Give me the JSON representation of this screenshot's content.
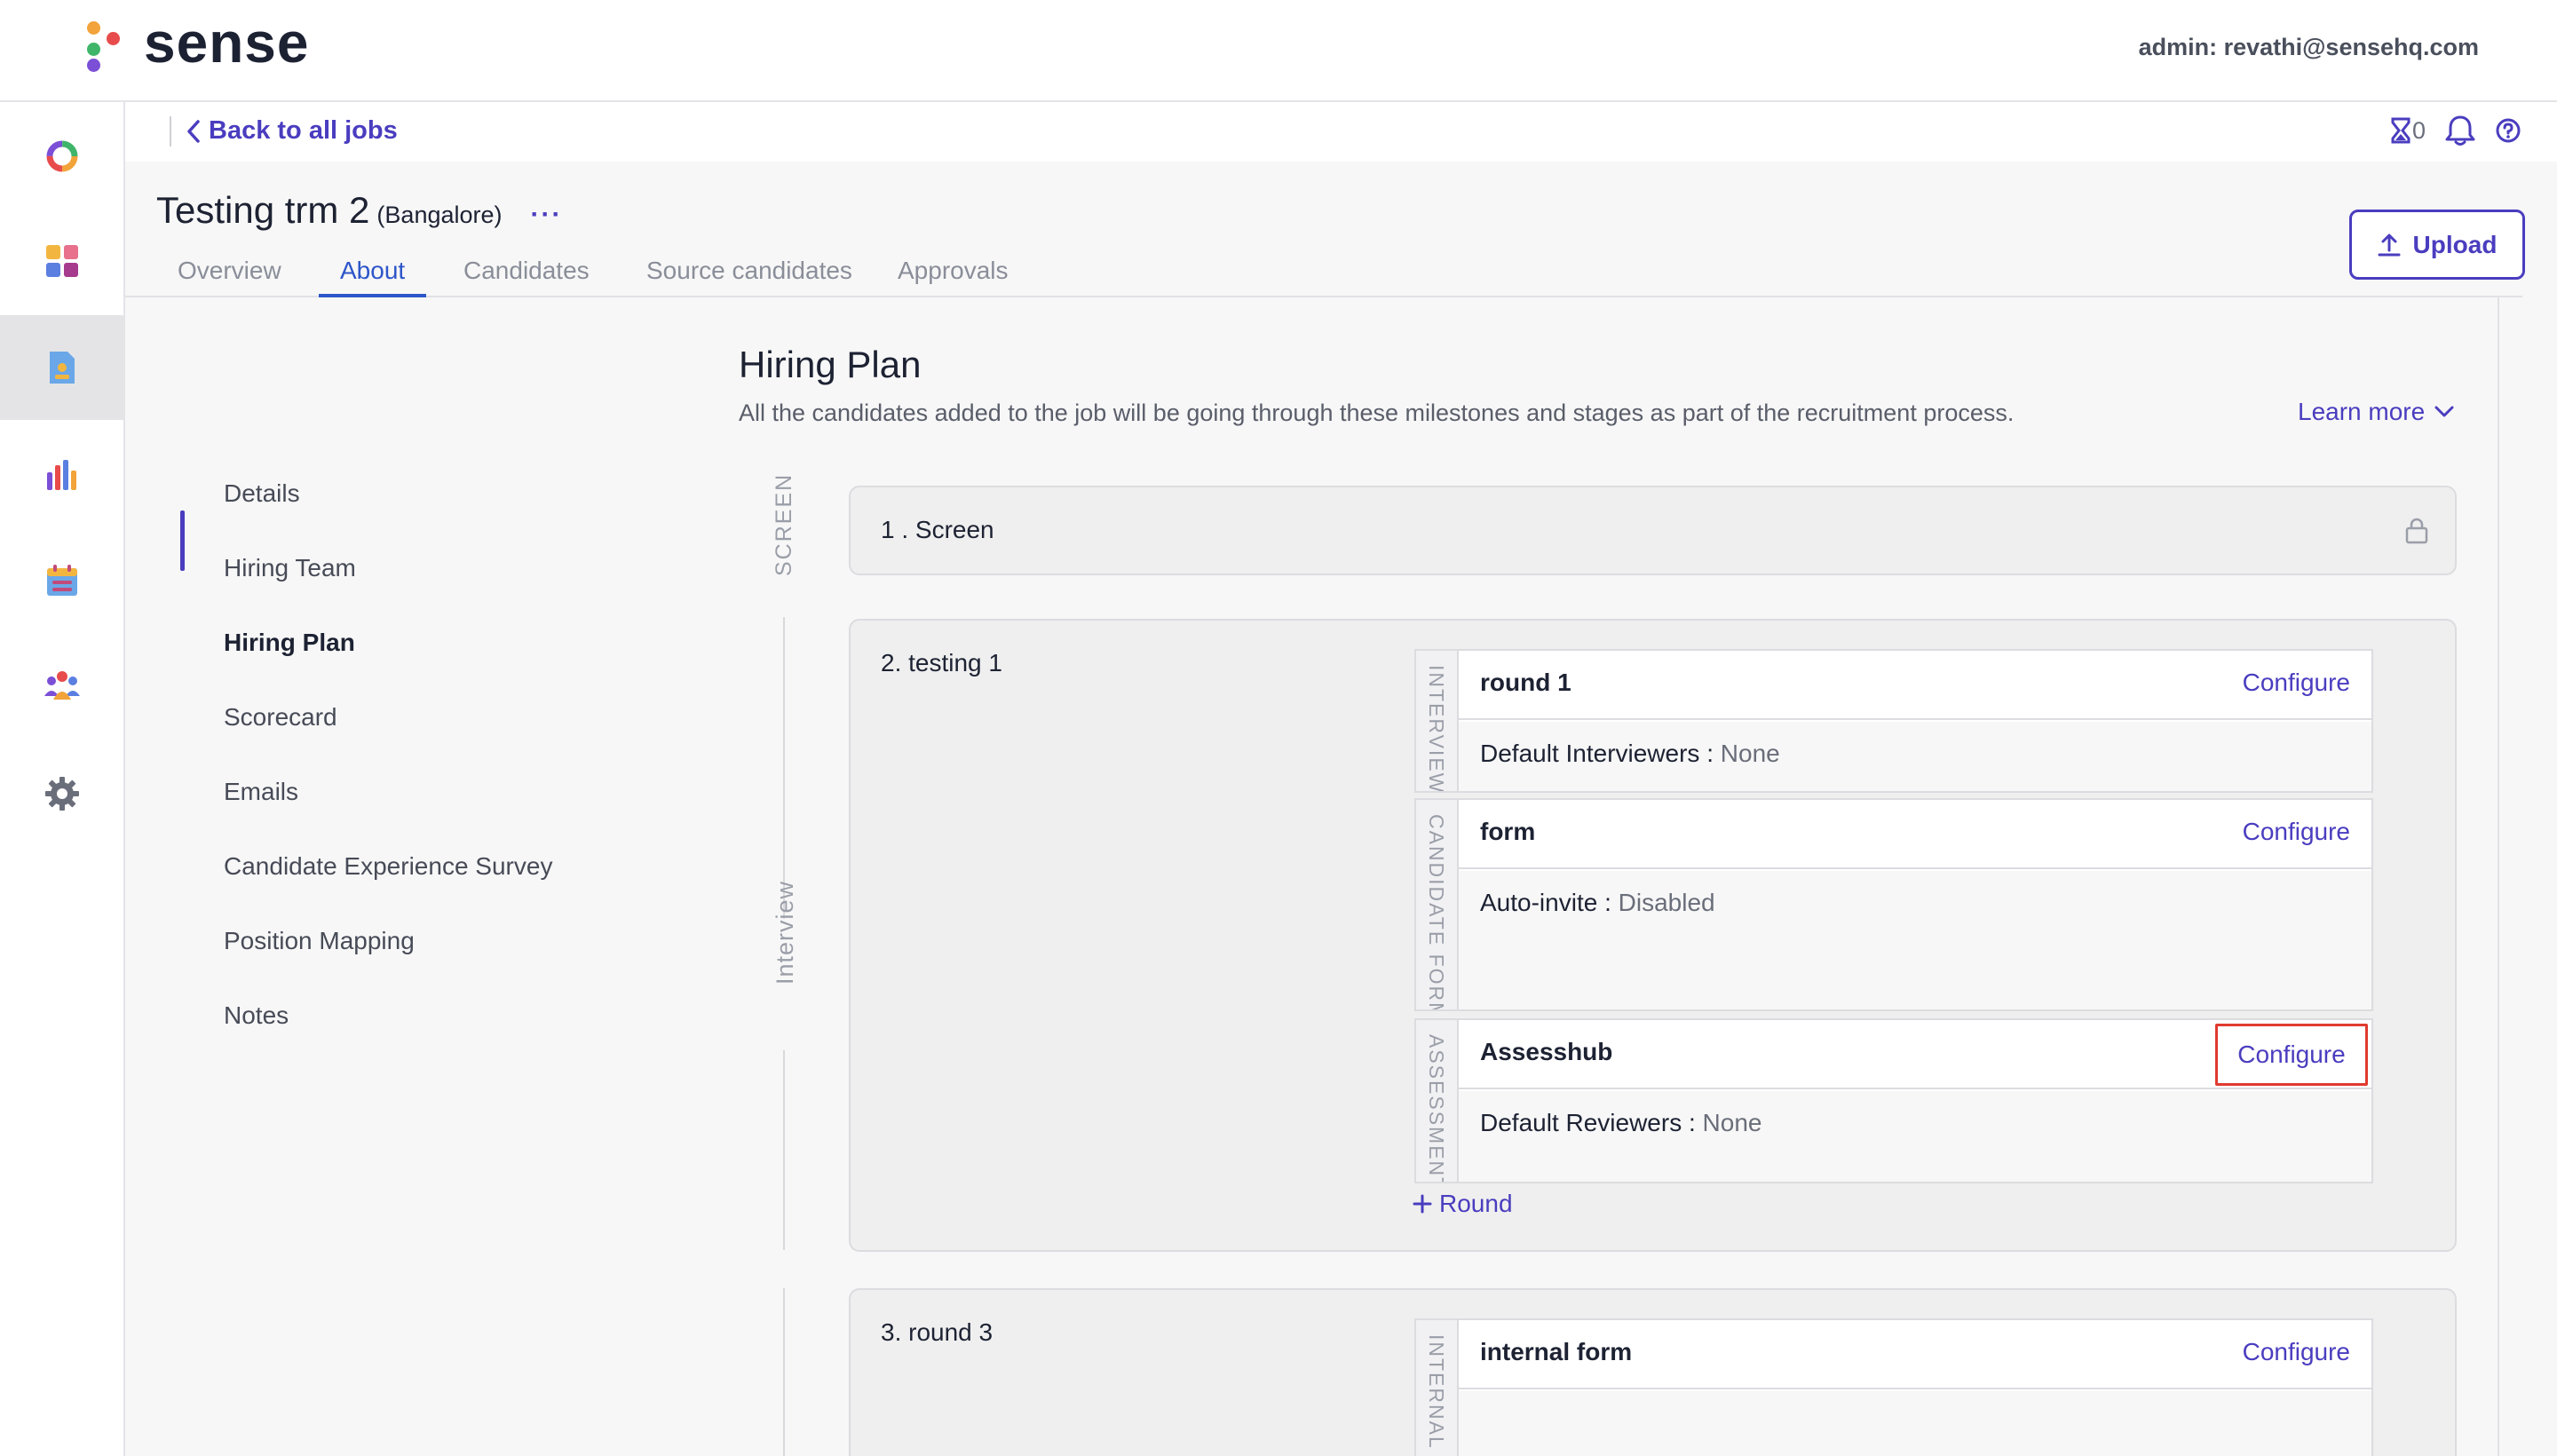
{
  "app": {
    "logo_text": "sense",
    "admin_label": "admin: revathi@sensehq.com"
  },
  "rail": {
    "items": [
      {
        "name": "dashboard-ring",
        "active": false
      },
      {
        "name": "apps-grid",
        "active": false
      },
      {
        "name": "jobs",
        "active": true
      },
      {
        "name": "analytics",
        "active": false
      },
      {
        "name": "calendar",
        "active": false
      },
      {
        "name": "people",
        "active": false
      },
      {
        "name": "settings",
        "active": false
      }
    ]
  },
  "header": {
    "back_label": "Back to all jobs",
    "hourglass_count": "0",
    "job_name": "Testing trm 2",
    "job_location": "(Bangalore)",
    "more_label": "···",
    "upload_label": "Upload"
  },
  "tabs": [
    {
      "label": "Overview",
      "active": false
    },
    {
      "label": "About",
      "active": true
    },
    {
      "label": "Candidates",
      "active": false
    },
    {
      "label": "Source candidates",
      "active": false
    },
    {
      "label": "Approvals",
      "active": false
    }
  ],
  "subnav": [
    {
      "label": "Details",
      "active": false
    },
    {
      "label": "Hiring Team",
      "active": false
    },
    {
      "label": "Hiring Plan",
      "active": true
    },
    {
      "label": "Scorecard",
      "active": false
    },
    {
      "label": "Emails",
      "active": false
    },
    {
      "label": "Candidate Experience Survey",
      "active": false
    },
    {
      "label": "Position Mapping",
      "active": false
    },
    {
      "label": "Notes",
      "active": false
    }
  ],
  "hiring_plan": {
    "title": "Hiring Plan",
    "description": "All the candidates added to the job will be going through these milestones and stages as part of the recruitment process.",
    "learn_more": "Learn more",
    "milestones": {
      "screen": "SCREEN",
      "interview": "Interview"
    },
    "stages": [
      {
        "label": "1 . Screen",
        "locked": true
      },
      {
        "label": "2. testing 1"
      },
      {
        "label": "3. round 3"
      }
    ],
    "rounds": [
      {
        "type": "INTERVIEW",
        "name": "round 1",
        "configure": "Configure",
        "meta_key": "Default Interviewers :",
        "meta_val": "None"
      },
      {
        "type": "CANDIDATE FORM",
        "name": "form",
        "configure": "Configure",
        "meta_key": "Auto-invite :",
        "meta_val": "Disabled"
      },
      {
        "type": "ASSESSMENT",
        "name": "Assesshub",
        "configure": "Configure",
        "meta_key": "Default Reviewers :",
        "meta_val": "None"
      },
      {
        "type": "INTERNAL FORM",
        "name": "internal form",
        "configure": "Configure",
        "meta_key": "",
        "meta_val": ""
      }
    ],
    "add_round_label": "Round"
  },
  "colors": {
    "accent": "#4a3dbf",
    "tab_active": "#2d56c9",
    "highlight": "#e03a2f"
  }
}
